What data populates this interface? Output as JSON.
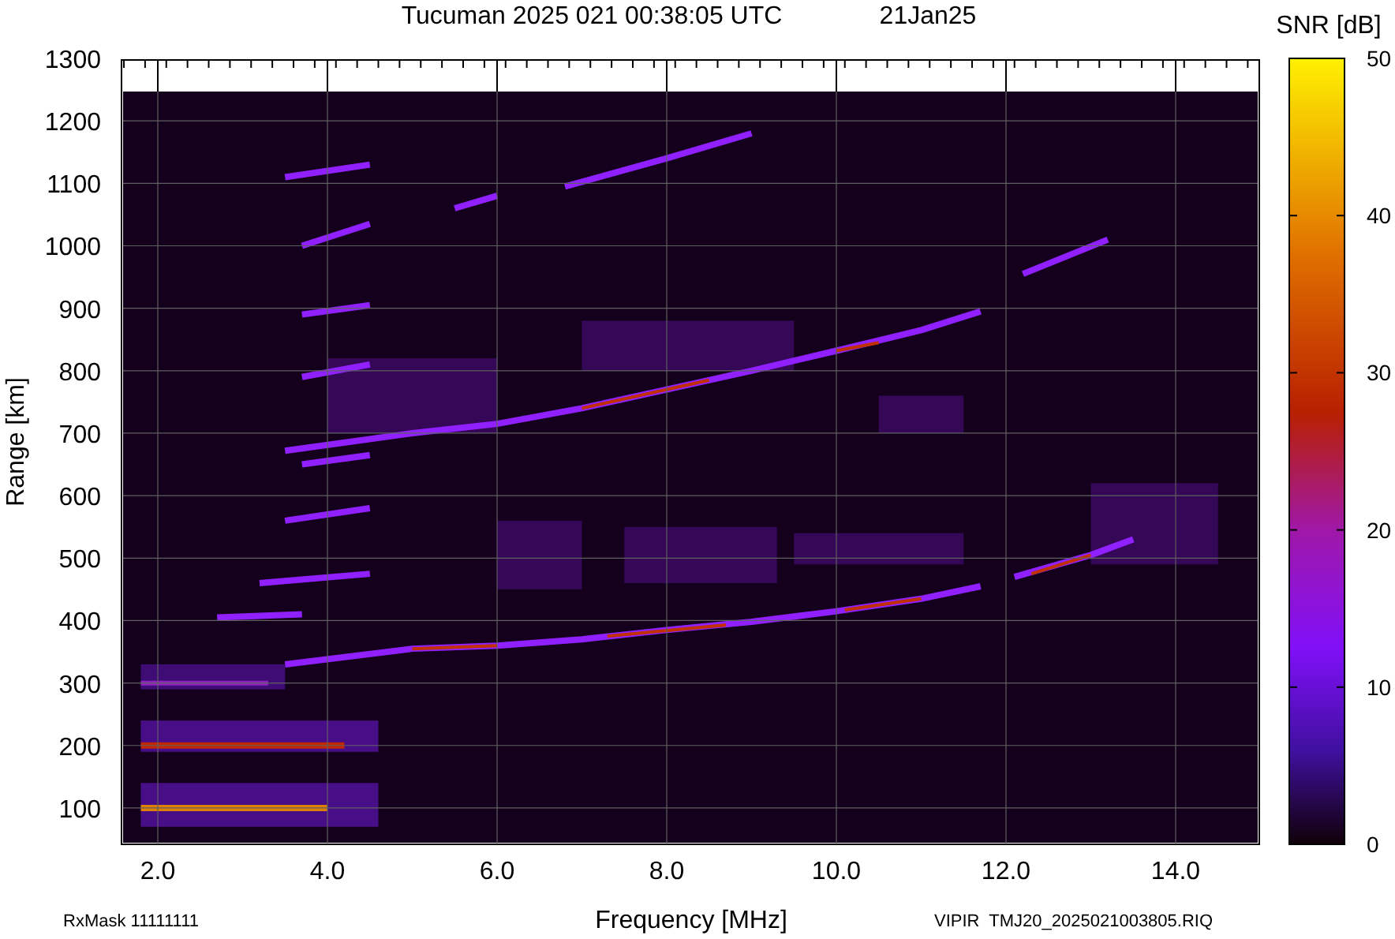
{
  "plot": {
    "title": "Tucuman 2025 021 00:38:05 UTC",
    "date": "21Jan25",
    "ylabel": "Range [km]",
    "xlabel": "Frequency [MHz]",
    "yticks": [
      "1300",
      "1200",
      "1100",
      "1000",
      "900",
      "800",
      "700",
      "600",
      "500",
      "400",
      "300",
      "200",
      "100"
    ],
    "xticks": [
      "2.0",
      "4.0",
      "6.0",
      "8.0",
      "10.0",
      "12.0",
      "14.0"
    ]
  },
  "colorbar": {
    "label": "SNR [dB]",
    "ticks": [
      "50",
      "40",
      "30",
      "20",
      "10",
      "0"
    ]
  },
  "footer": {
    "rx_mask": "RxMask 11111111",
    "file": "VIPIR  TMJ20_2025021003805.RIQ"
  }
}
